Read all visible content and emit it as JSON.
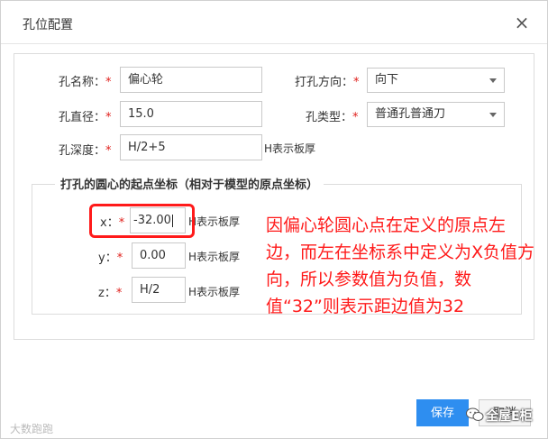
{
  "dialog": {
    "title": "孔位配置",
    "close_glyph": "×"
  },
  "form": {
    "name_label": "孔名称：",
    "name_value": "偏心轮",
    "direction_label": "打孔方向：",
    "direction_value": "向下",
    "diameter_label": "孔直径：",
    "diameter_value": "15.0",
    "type_label": "孔类型：",
    "type_value": "普通孔普通刀",
    "depth_label": "孔深度：",
    "depth_value": "H/2+5",
    "depth_hint": "H表示板厚",
    "required_mark": "*"
  },
  "coords": {
    "legend": "打孔的圆心的起点坐标（相对于模型的原点坐标）",
    "x_label": "x：",
    "x_value": "-32.00",
    "x_hint": "H表示板厚",
    "y_label": "y：",
    "y_value": "0.00",
    "y_hint": "H表示板厚",
    "z_label": "z：",
    "z_value": "H/2",
    "z_hint": "H表示板厚"
  },
  "annotation": {
    "text": "因偏心轮圆心点在定义的原点左边，而左在坐标系中定义为X负值方向，所以参数值为负值，数值“32”则表示距边值为32",
    "color": "#ff1a1a"
  },
  "buttons": {
    "save_label": "保存",
    "cancel_label": "取消"
  },
  "watermarks": {
    "left": "大数跑跑",
    "right": "全屋E柜"
  },
  "colors": {
    "primary": "#2e8ef0",
    "required": "#e0201c"
  }
}
